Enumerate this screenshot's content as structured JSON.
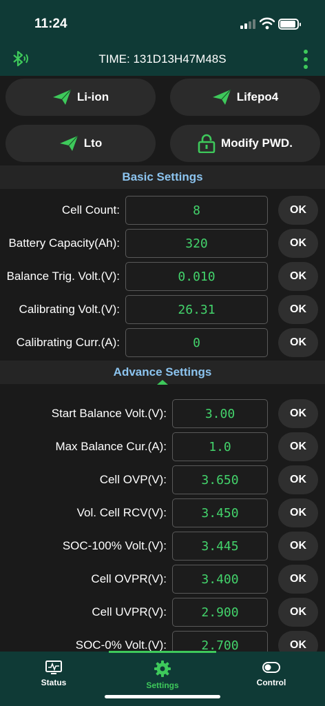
{
  "status_bar": {
    "time": "11:24",
    "battery_level": 0.85
  },
  "header": {
    "title": "TIME: 131D13H47M48S"
  },
  "modes": [
    {
      "label": "Li-ion",
      "icon": "send-icon"
    },
    {
      "label": "Lifepo4",
      "icon": "send-icon"
    },
    {
      "label": "Lto",
      "icon": "send-icon"
    },
    {
      "label": "Modify PWD.",
      "icon": "lock-icon"
    }
  ],
  "basic": {
    "title": "Basic Settings",
    "rows": [
      {
        "label": "Cell Count:",
        "value": "8",
        "ok": "OK"
      },
      {
        "label": "Battery Capacity(Ah):",
        "value": "320",
        "ok": "OK"
      },
      {
        "label": "Balance Trig. Volt.(V):",
        "value": "0.010",
        "ok": "OK"
      },
      {
        "label": "Calibrating Volt.(V):",
        "value": "26.31",
        "ok": "OK"
      },
      {
        "label": "Calibrating Curr.(A):",
        "value": "0",
        "ok": "OK"
      }
    ]
  },
  "advance": {
    "title": "Advance Settings",
    "rows": [
      {
        "label": "Start Balance Volt.(V):",
        "value": "3.00",
        "ok": "OK"
      },
      {
        "label": "Max Balance Cur.(A):",
        "value": "1.0",
        "ok": "OK"
      },
      {
        "label": "Cell OVP(V):",
        "value": "3.650",
        "ok": "OK"
      },
      {
        "label": "Vol. Cell RCV(V):",
        "value": "3.450",
        "ok": "OK"
      },
      {
        "label": "SOC-100% Volt.(V):",
        "value": "3.445",
        "ok": "OK"
      },
      {
        "label": "Cell OVPR(V):",
        "value": "3.400",
        "ok": "OK"
      },
      {
        "label": "Cell UVPR(V):",
        "value": "2.900",
        "ok": "OK"
      },
      {
        "label": "SOC-0% Volt.(V):",
        "value": "2.700",
        "ok": "OK"
      }
    ]
  },
  "tabs": [
    {
      "label": "Status",
      "icon": "monitor-icon",
      "active": false
    },
    {
      "label": "Settings",
      "icon": "gear-icon",
      "active": true
    },
    {
      "label": "Control",
      "icon": "toggle-icon",
      "active": false
    }
  ],
  "colors": {
    "accent": "#3ec95b",
    "header_bg": "#0f3a36",
    "section_title": "#8cc4ef",
    "value_text": "#43d36b"
  }
}
